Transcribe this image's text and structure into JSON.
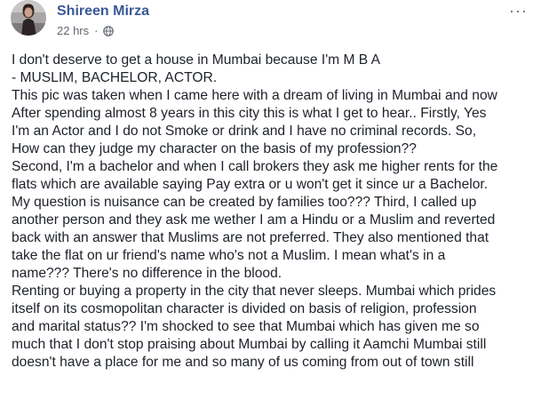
{
  "post": {
    "author": "Shireen Mirza",
    "timestamp": "22 hrs",
    "separator": "·",
    "privacy_icon": "globe-icon",
    "menu_label": "···",
    "lines": [
      "I don't deserve to get a house in Mumbai because I'm M B A",
      "- MUSLIM, BACHELOR, ACTOR.",
      "This pic was taken when I came here with a dream of living in Mumbai and now",
      "After spending almost 8 years in this city this is what I get to hear.. Firstly, Yes",
      "I'm an Actor and I do not Smoke or drink and I have no criminal records. So,",
      "How can they judge my character on the basis of my profession??",
      "Second, I'm a bachelor and when I call brokers they ask me higher rents for the",
      "flats which are available saying Pay extra or u won't get it since ur a Bachelor.",
      "My question is nuisance can be created by families too??? Third, I called up",
      "another person and they ask me wether I am a Hindu or a Muslim and reverted",
      "back with an answer that Muslims are not preferred. They also mentioned that",
      "take the flat on ur friend's name who's not a Muslim. I mean what's in a",
      "name??? There's no difference in the blood.",
      "Renting or buying a property in the city that never sleeps. Mumbai which prides",
      "itself on its cosmopolitan character is divided on basis of religion, profession",
      "and marital status?? I'm shocked to see that Mumbai which has given me so",
      "much that I don't stop praising about Mumbai by calling it Aamchi Mumbai still",
      "doesn't have a place for me and so many of us coming from out of town still"
    ]
  },
  "colors": {
    "author": "#385898",
    "meta": "#616770",
    "text": "#1d2129"
  }
}
